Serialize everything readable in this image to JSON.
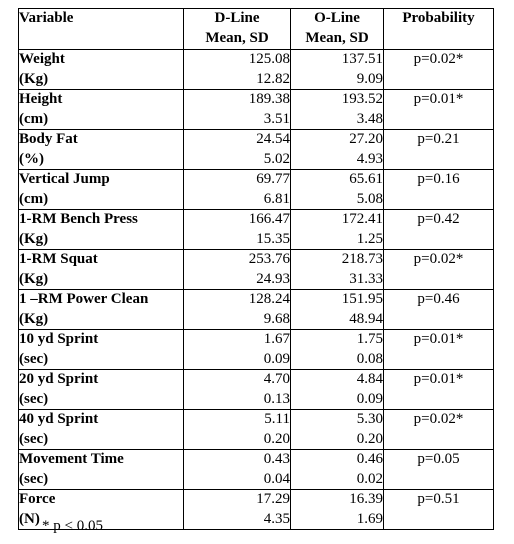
{
  "table": {
    "name": "anthropometric-and-performance-comparison-table",
    "columns": [
      {
        "key": "variable",
        "label_line1": "Variable",
        "label_line2": ""
      },
      {
        "key": "dline",
        "label_line1": "D-Line",
        "label_line2": "Mean, SD"
      },
      {
        "key": "oline",
        "label_line1": "O-Line",
        "label_line2": "Mean, SD"
      },
      {
        "key": "probability",
        "label_line1": "Probability",
        "label_line2": ""
      }
    ],
    "rows": [
      {
        "variable_line1": "Weight",
        "variable_line2": "(Kg)",
        "dline_mean": "125.08",
        "dline_sd": "12.82",
        "oline_mean": "137.51",
        "oline_sd": "9.09",
        "probability": "p=0.02*"
      },
      {
        "variable_line1": "Height",
        "variable_line2": "(cm)",
        "dline_mean": "189.38",
        "dline_sd": "3.51",
        "oline_mean": "193.52",
        "oline_sd": "3.48",
        "probability": "p=0.01*"
      },
      {
        "variable_line1": "Body Fat",
        "variable_line2": "(%)",
        "dline_mean": "24.54",
        "dline_sd": "5.02",
        "oline_mean": "27.20",
        "oline_sd": "4.93",
        "probability": "p=0.21"
      },
      {
        "variable_line1": "Vertical Jump",
        "variable_line2": "(cm)",
        "dline_mean": "69.77",
        "dline_sd": "6.81",
        "oline_mean": "65.61",
        "oline_sd": "5.08",
        "probability": "p=0.16"
      },
      {
        "variable_line1": "1-RM Bench Press",
        "variable_line2": "(Kg)",
        "dline_mean": "166.47",
        "dline_sd": "15.35",
        "oline_mean": "172.41",
        "oline_sd": "1.25",
        "probability": "p=0.42"
      },
      {
        "variable_line1": "1-RM Squat",
        "variable_line2": "(Kg)",
        "dline_mean": "253.76",
        "dline_sd": "24.93",
        "oline_mean": "218.73",
        "oline_sd": "31.33",
        "probability": "p=0.02*"
      },
      {
        "variable_line1": "1 –RM Power Clean",
        "variable_line2": "(Kg)",
        "dline_mean": "128.24",
        "dline_sd": "9.68",
        "oline_mean": "151.95",
        "oline_sd": "48.94",
        "probability": "p=0.46"
      },
      {
        "variable_line1": "10 yd Sprint",
        "variable_line2": "(sec)",
        "dline_mean": "1.67",
        "dline_sd": "0.09",
        "oline_mean": "1.75",
        "oline_sd": "0.08",
        "probability": "p=0.01*"
      },
      {
        "variable_line1": "20 yd Sprint",
        "variable_line2": "(sec)",
        "dline_mean": "4.70",
        "dline_sd": "0.13",
        "oline_mean": "4.84",
        "oline_sd": "0.09",
        "probability": "p=0.01*"
      },
      {
        "variable_line1": "40 yd Sprint",
        "variable_line2": "(sec)",
        "dline_mean": "5.11",
        "dline_sd": "0.20",
        "oline_mean": "5.30",
        "oline_sd": "0.20",
        "probability": "p=0.02*"
      },
      {
        "variable_line1": "Movement Time",
        "variable_line2": "(sec)",
        "dline_mean": "0.43",
        "dline_sd": "0.04",
        "oline_mean": "0.46",
        "oline_sd": "0.02",
        "probability": "p=0.05"
      },
      {
        "variable_line1": "Force",
        "variable_line2": "(N)",
        "dline_mean": "17.29",
        "dline_sd": "4.35",
        "oline_mean": "16.39",
        "oline_sd": "1.69",
        "probability": "p=0.51"
      }
    ],
    "footnote": "* p < 0.05"
  },
  "colors": {
    "background": "#ffffff",
    "text": "#000000",
    "border": "#000000"
  }
}
